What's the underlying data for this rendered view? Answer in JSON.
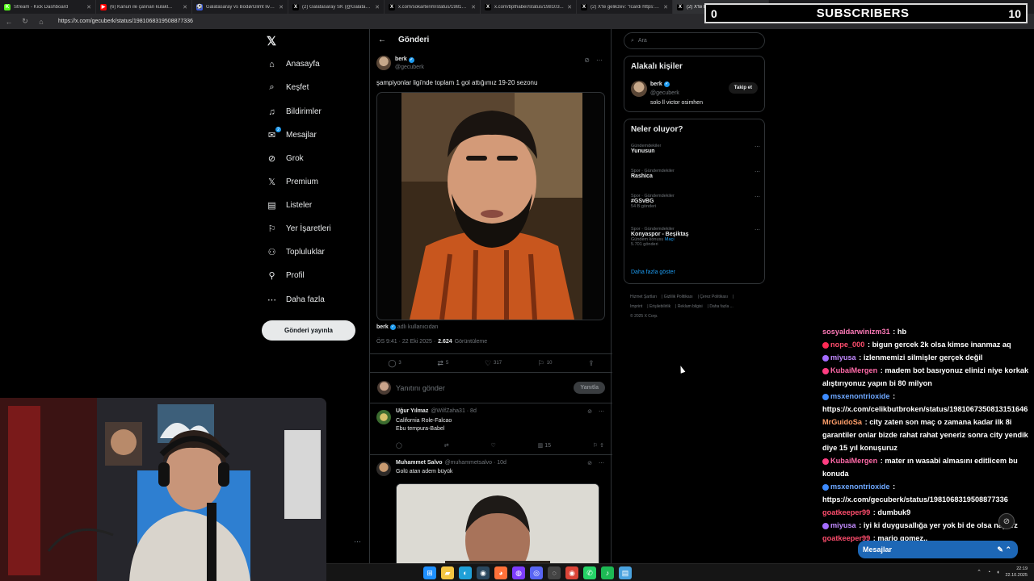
{
  "browser": {
    "tabs": [
      {
        "label": "Stream - Kick Dashboard",
        "fav_color": "#53fc18",
        "fav_glyph": "K"
      },
      {
        "label": "(6) Kanun ile çalınan kulakl...",
        "fav_color": "#ff0000",
        "fav_glyph": "▶"
      },
      {
        "label": "Galatasaray vs Bodø/Glimt live s...",
        "fav_color": "#3b5bdb",
        "fav_glyph": "⚽"
      },
      {
        "label": "(2) Galatasaray SK (@Galatasaray...",
        "fav_color": "#000000",
        "fav_glyph": "X"
      },
      {
        "label": "x.com/sokarterim/status/198105...",
        "fav_color": "#000000",
        "fav_glyph": "X"
      },
      {
        "label": "x.com/bpthaber/status/198103...",
        "fav_color": "#000000",
        "fav_glyph": "X"
      },
      {
        "label": "(2) X'te gelikzev: \"Icardi https://...",
        "fav_color": "#000000",
        "fav_glyph": "X"
      },
      {
        "label": "(2) X'te berk: \"şampiyonlar...",
        "fav_color": "#000000",
        "fav_glyph": "X"
      }
    ],
    "url": "https://x.com/gecuberk/status/1981068319508877336"
  },
  "subscribers": {
    "left_count": "0",
    "title": "SUBSCRIBERS",
    "right_count": "10"
  },
  "nav": {
    "items": [
      {
        "label": "Anasayfa",
        "icon": "home-icon",
        "glyph": "⌂"
      },
      {
        "label": "Keşfet",
        "icon": "search-icon",
        "glyph": "⌕"
      },
      {
        "label": "Bildirimler",
        "icon": "bell-icon",
        "glyph": "♫"
      },
      {
        "label": "Mesajlar",
        "icon": "mail-icon",
        "glyph": "✉"
      },
      {
        "label": "Grok",
        "icon": "grok-icon",
        "glyph": "⊘"
      },
      {
        "label": "Premium",
        "icon": "x-premium-icon",
        "glyph": "𝕏"
      },
      {
        "label": "Listeler",
        "icon": "list-icon",
        "glyph": "▤"
      },
      {
        "label": "Yer İşaretleri",
        "icon": "bookmark-icon",
        "glyph": "⚐"
      },
      {
        "label": "Topluluklar",
        "icon": "people-icon",
        "glyph": "⚇"
      },
      {
        "label": "Profil",
        "icon": "person-icon",
        "glyph": "⚲"
      },
      {
        "label": "Daha fazla",
        "icon": "more-circle-icon",
        "glyph": "⋯"
      }
    ],
    "messages_badge": "2",
    "post_button": "Gönderi yayınla"
  },
  "main": {
    "header": "Gönderi",
    "tweet": {
      "name": "berk",
      "handle": "@gecuberk",
      "text": "şampiyonlar ligi'nde toplam 1 gol attığımız 19-20 sezonu",
      "attrib_name": "berk",
      "attrib_suffix": "adlı kullanıcıdan",
      "time": "ÖS 9:41 · 22 Eki 2025 ·",
      "views": "2.624",
      "views_label": "Görüntüleme",
      "replies": "3",
      "reposts": "5",
      "likes": "317",
      "bookmarks": "10"
    },
    "reply_placeholder": "Yanıtını gönder",
    "reply_button": "Yanıtla",
    "replies": [
      {
        "name": "Uğur Yılmaz",
        "handle": "@WilfZaha31 · 8d",
        "line1": "California Role-Falcao",
        "line2": "Ebu tempura-Babel",
        "views": "15"
      },
      {
        "name": "Muhammet Salvo",
        "handle": "@muhammetsalvo · 10d",
        "line1": "Golü atan adem büyük"
      }
    ]
  },
  "right": {
    "search_placeholder": "Ara",
    "related_title": "Alakalı kişiler",
    "related": {
      "name": "berk",
      "handle": "@gecuberk",
      "bio": "solo ll victor osimhen",
      "follow": "Takip et"
    },
    "trends_title": "Neler oluyor?",
    "trends": [
      {
        "cat": "Gündemdekiler",
        "name": "Yunusun",
        "sub": ""
      },
      {
        "cat": "Spor · Gündemdekiler",
        "name": "Rashica",
        "sub": ""
      },
      {
        "cat": "Spor · Gündemdekiler",
        "name": "#GSvBG",
        "sub": "54 B gönderi"
      },
      {
        "cat": "Spor · Gündemdekiler",
        "name": "Konyaspor - Beşiktaş",
        "sub": "Gündem konusu",
        "link": "Maçı",
        "sub2": "5.701 gönderi"
      }
    ],
    "show_more": "Daha fazla göster",
    "footer": [
      "Hizmet Şartları",
      "Gizlilik Politikası",
      "Çerez Politikası",
      "Imprint",
      "Erişilebilirlik",
      "Reklam bilgisi",
      "Daha fazla ...",
      "© 2025 X Corp."
    ]
  },
  "chat": {
    "messages": [
      {
        "user": "sosyaldarwinizm31",
        "color": "#ff7ab8",
        "text": "hb",
        "badge": ""
      },
      {
        "user": "nope_000",
        "color": "#ff4d6d",
        "text": "bigun gercek 2k olsa kimse inanmaz aq",
        "badge": "#ff2a55"
      },
      {
        "user": "miyusa",
        "color": "#c38bff",
        "text": "izlenmemizi silmişler gerçek değil",
        "badge": "#a36bff"
      },
      {
        "user": "KubaiMergen",
        "color": "#ff6aa8",
        "text": "madem bot basıyonuz elinizi niye korkak alıştırıyonuz yapın bi 80 milyon",
        "badge": "#ff3d81"
      },
      {
        "user": "msxenontrioxide",
        "color": "#6ea8ff",
        "text": "https://x.com/celikbutbroken/status/1981067350813151646",
        "badge": "#3d8bff"
      },
      {
        "user": "MrGuidoSa",
        "color": "#ff9f6a",
        "text": "city zaten son maç o zamana kadar ilk 8i garantiler onlar bizde rahat rahat yeneriz sonra city yendik diye 15 yıl konuşuruz",
        "badge": ""
      },
      {
        "user": "KubaiMergen",
        "color": "#ff6aa8",
        "text": "mater ın wasabi almasını editlicem bu konuda",
        "badge": "#ff3d81"
      },
      {
        "user": "msxenontrioxide",
        "color": "#6ea8ff",
        "text": "https://x.com/gecuberk/status/1981068319508877336",
        "badge": "#3d8bff"
      },
      {
        "user": "goatkeeper99",
        "color": "#ff4d6d",
        "text": "dumbuk9",
        "badge": ""
      },
      {
        "user": "miyusa",
        "color": "#c38bff",
        "text": "iyi ki duygusallığa yer yok bi de olsa naparz",
        "badge": "#a36bff"
      },
      {
        "user": "goatkeeper99",
        "color": "#ff4d6d",
        "text": "mario gomez..",
        "badge": ""
      }
    ],
    "dm_label": "Mesajlar"
  },
  "taskbar": {
    "time": "22:19",
    "date": "22.10.2025",
    "apps": [
      {
        "icon": "windows-start-icon",
        "glyph": "⊞",
        "color": "#1e90ff"
      },
      {
        "icon": "file-explorer-icon",
        "glyph": "▰",
        "color": "#f4c542"
      },
      {
        "icon": "edge-icon",
        "glyph": "◐",
        "color": "#1fa0d8"
      },
      {
        "icon": "steam-icon",
        "glyph": "◉",
        "color": "#2a475e"
      },
      {
        "icon": "firefox-icon",
        "glyph": "◕",
        "color": "#ff7139"
      },
      {
        "icon": "spotify-like-icon",
        "glyph": "◍",
        "color": "#7d3cff"
      },
      {
        "icon": "discord-icon",
        "glyph": "◎",
        "color": "#5865f2"
      },
      {
        "icon": "obs-icon",
        "glyph": "◌",
        "color": "#444"
      },
      {
        "icon": "chrome-icon",
        "glyph": "◉",
        "color": "#db4437"
      },
      {
        "icon": "whatsapp-icon",
        "glyph": "✆",
        "color": "#25d366"
      },
      {
        "icon": "spotify-icon",
        "glyph": "♪",
        "color": "#1db954"
      },
      {
        "icon": "notepad-icon",
        "glyph": "▤",
        "color": "#4aa3df"
      }
    ]
  }
}
